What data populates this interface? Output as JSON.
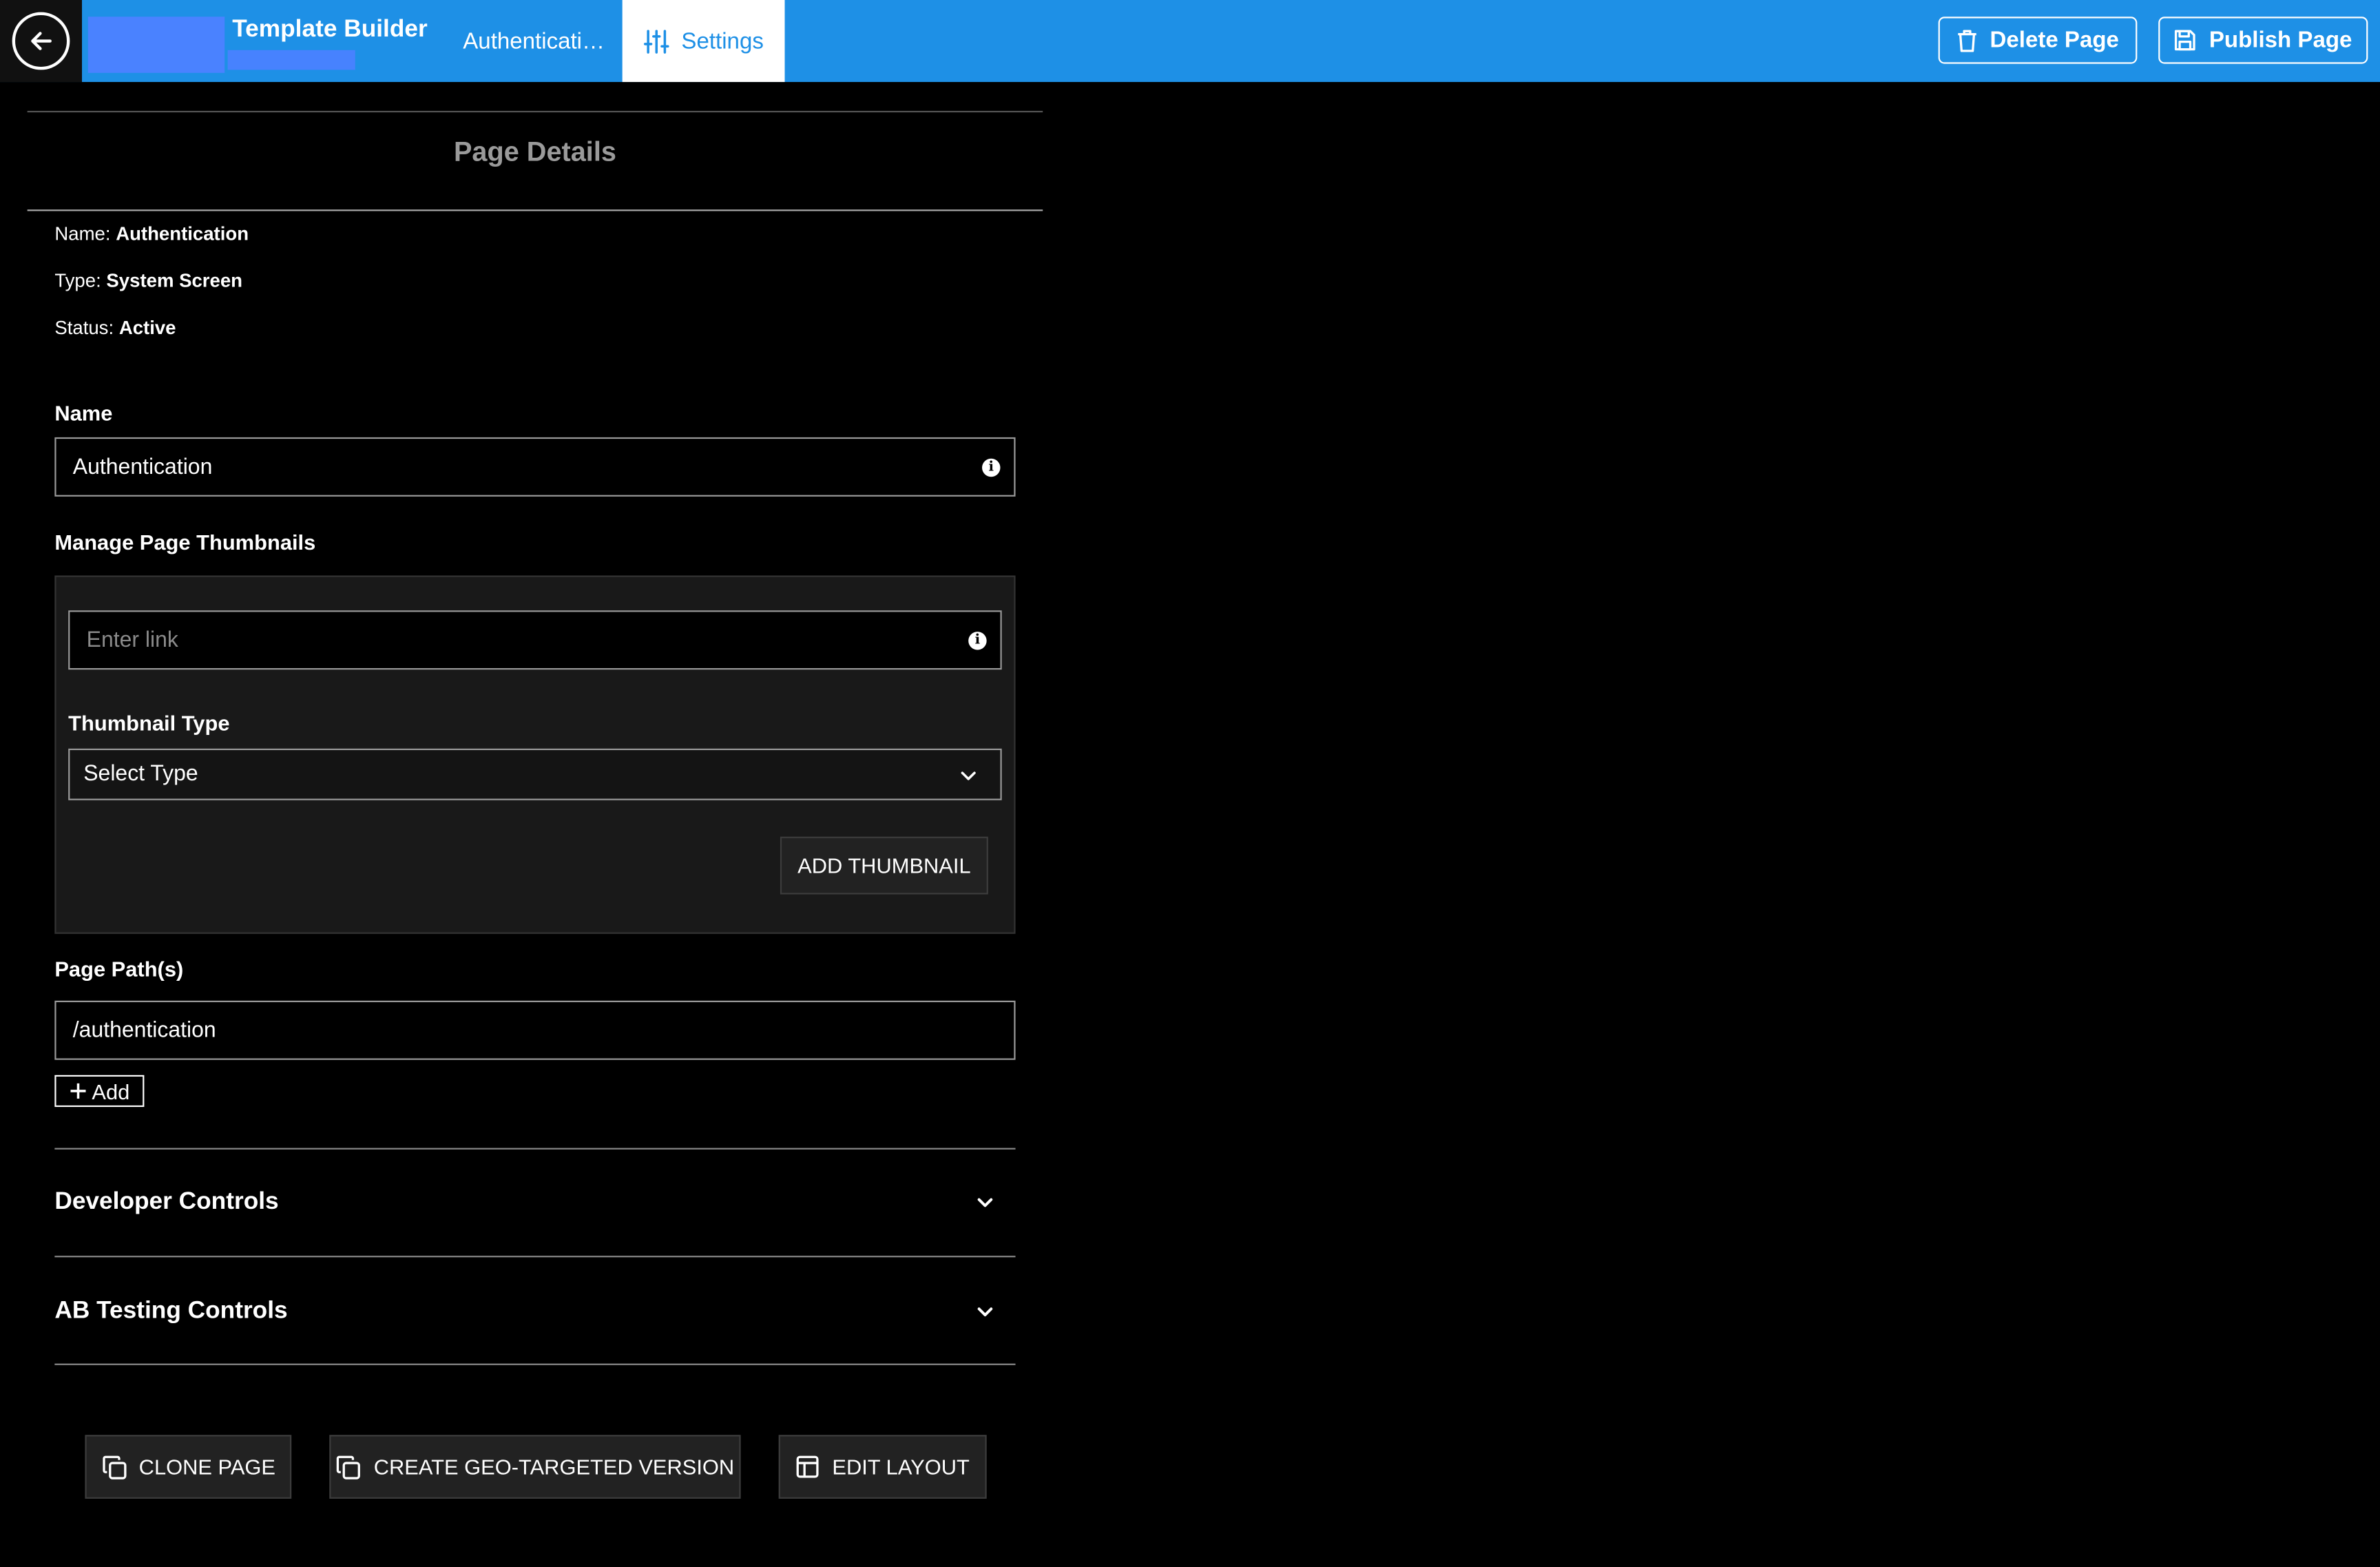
{
  "header": {
    "app_title": "Template Builder",
    "tab_page": "Authenticati…",
    "tab_settings": "Settings",
    "delete_label": "Delete Page",
    "publish_label": "Publish Page",
    "accent_color": "#1e90e6"
  },
  "panel": {
    "title": "Page Details",
    "meta": {
      "name_label": "Name:",
      "name_value": "Authentication",
      "type_label": "Type:",
      "type_value": "System Screen",
      "status_label": "Status:",
      "status_value": "Active"
    },
    "name_field": {
      "label": "Name",
      "value": "Authentication"
    },
    "thumbnails": {
      "label": "Manage Page Thumbnails",
      "link_placeholder": "Enter link",
      "type_label": "Thumbnail Type",
      "type_selected": "Select Type",
      "add_button": "ADD THUMBNAIL"
    },
    "paths": {
      "label": "Page Path(s)",
      "values": [
        "/authentication"
      ],
      "add_button": "Add"
    },
    "accordions": [
      {
        "label": "Developer Controls"
      },
      {
        "label": "AB Testing Controls"
      }
    ],
    "actions": {
      "clone": "CLONE PAGE",
      "geo": "CREATE GEO-TARGETED VERSION",
      "edit_layout": "EDIT LAYOUT"
    }
  },
  "icons": [
    "arrow-left-icon",
    "sliders-icon",
    "trash-icon",
    "save-icon",
    "info-icon",
    "chevron-down-icon",
    "plus-icon",
    "copy-icon",
    "layout-icon"
  ]
}
